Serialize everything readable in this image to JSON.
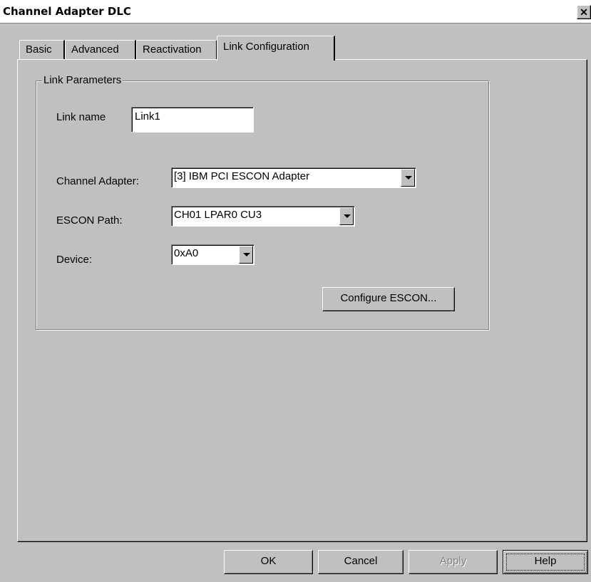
{
  "window": {
    "title": "Channel Adapter DLC",
    "close_glyph": "✕"
  },
  "tabs": [
    {
      "label": "Basic",
      "active": false
    },
    {
      "label": "Advanced",
      "active": false
    },
    {
      "label": "Reactivation",
      "active": false
    },
    {
      "label": "Link Configuration",
      "active": true
    }
  ],
  "group": {
    "label": "Link Parameters",
    "link_name_label": "Link name",
    "link_name_value": "Link1",
    "channel_adapter_label": "Channel Adapter:",
    "channel_adapter_value": "[3] IBM PCI ESCON Adapter",
    "escon_path_label": "ESCON Path:",
    "escon_path_value": "CH01  LPAR0  CU3",
    "device_label": "Device:",
    "device_value": "0xA0",
    "configure_button": "Configure ESCON..."
  },
  "buttons": {
    "ok": "OK",
    "cancel": "Cancel",
    "apply": "Apply",
    "help": "Help"
  }
}
